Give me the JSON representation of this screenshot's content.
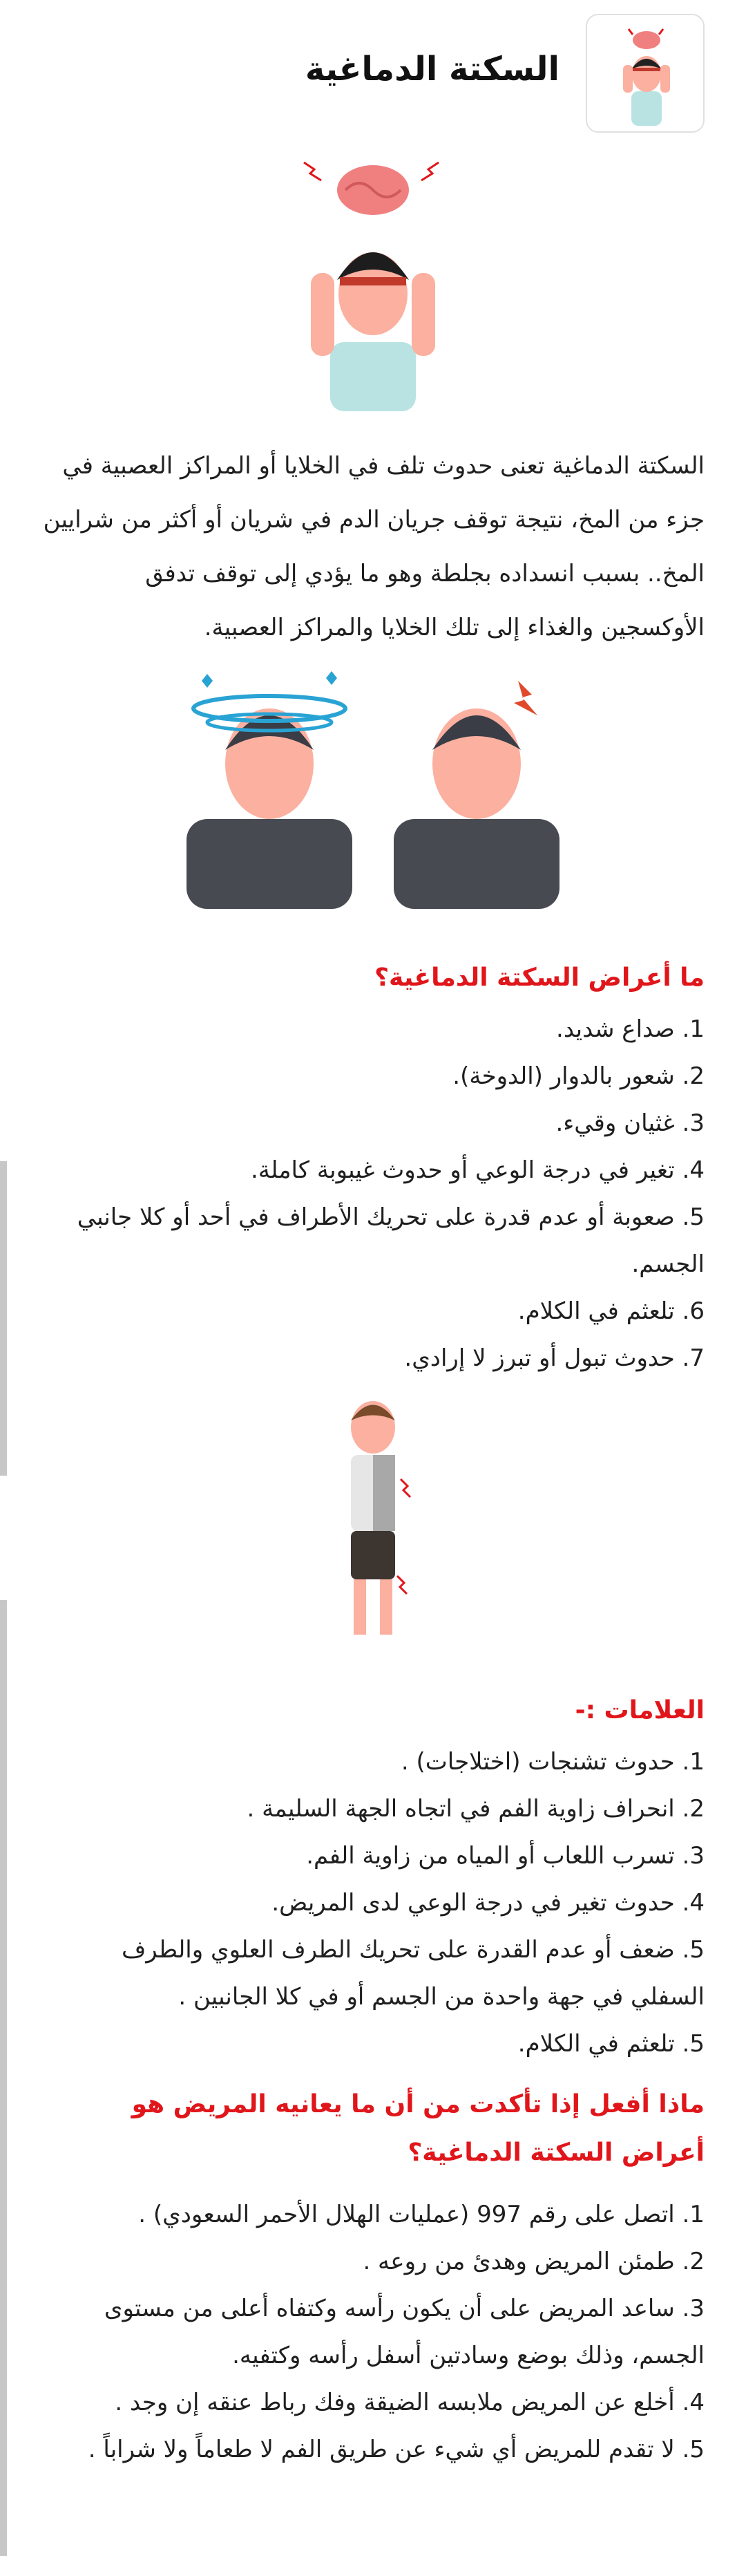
{
  "header": {
    "title": "السكتة الدماغية"
  },
  "intro": "السكتة الدماغية تعنى حدوث تلف في الخلايا أو المراكز العصبية في جزء من المخ، نتيجة توقف جريان الدم في شريان أو أكثر من شرايين المخ.. بسبب انسداده بجلطة وهو ما يؤدي إلى توقف تدفق الأوكسجين والغذاء إلى تلك الخلايا والمراكز العصبية.",
  "symptoms": {
    "title": "ما أعراض السكتة الدماغية؟",
    "items": [
      "1. صداع شديد.",
      "2. شعور بالدوار (الدوخة).",
      "3. غثيان وقيء.",
      "4. تغير في درجة الوعي أو حدوث غيبوبة كاملة.",
      "5. صعوبة أو عدم قدرة على تحريك الأطراف في أحد أو كلا جانبي الجسم.",
      "6. تلعثم في الكلام.",
      "7. حدوث تبول أو تبرز لا إرادي."
    ]
  },
  "signs": {
    "title": "العلامات :-",
    "items": [
      "1. حدوث تشنجات (اختلاجات) .",
      "2. انحراف زاوية الفم في اتجاه الجهة السليمة .",
      "3. تسرب اللعاب أو المياه من زاوية الفم.",
      "4. حدوث تغير في درجة الوعي لدى المريض.",
      "5. ضعف أو عدم القدرة على تحريك الطرف العلوي والطرف السفلي في جهة واحدة من الجسم أو في كلا الجانبين .",
      "5. تلعثم في الكلام."
    ]
  },
  "action": {
    "title": "ماذا أفعل إذا تأكدت من أن ما يعانيه المريض هو أعراض السكتة الدماغية؟",
    "items": [
      "1. اتصل على رقم 997 (عمليات الهلال الأحمر السعودي) .",
      "2. طمئن المريض وهدئ من روعه .",
      "3. ساعد المريض على أن يكون رأسه وكتفاه أعلى من مستوى الجسم، وذلك بوضع وسادتين أسفل رأسه وكتفيه.",
      "4. أخلع عن المريض ملابسه الضيقة وفك رباط عنقه إن وجد .",
      "5. لا تقدم للمريض أي شيء عن طريق الفم لا طعاماً ولا شراباً ."
    ]
  },
  "colors": {
    "accent": "#e0161b",
    "brain": "#f08080",
    "shirt": "#b9e3e3",
    "dark_shirt": "#474a51",
    "skin": "#fbb0a0"
  }
}
